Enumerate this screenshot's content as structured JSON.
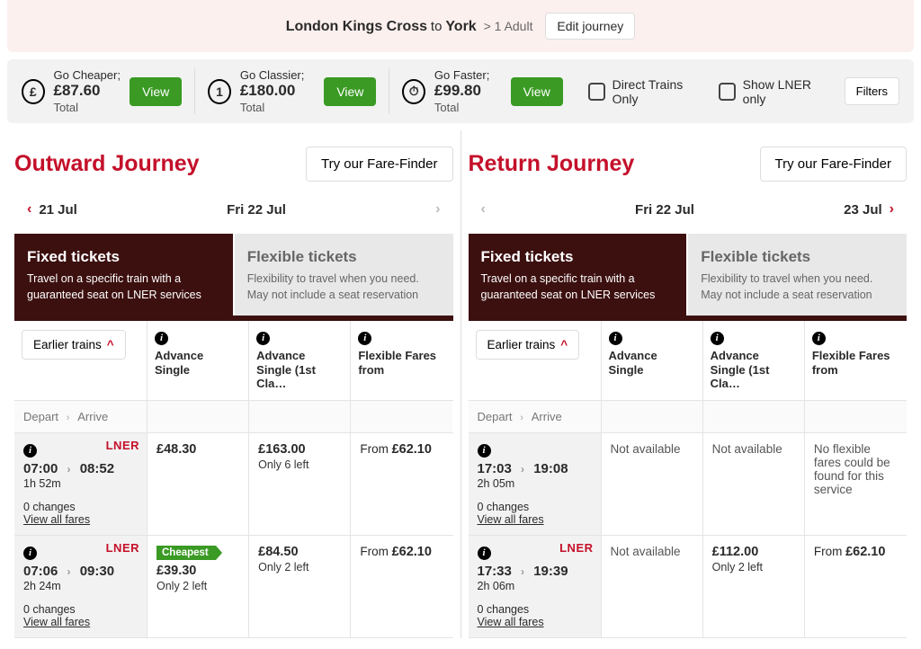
{
  "journey": {
    "from": "London Kings Cross",
    "to_word": "to",
    "dest": "York",
    "pax": "> 1 Adult",
    "edit": "Edit journey"
  },
  "promos": {
    "cheaper": {
      "label": "Go Cheaper;",
      "price": "£87.60",
      "total": "Total",
      "view": "View"
    },
    "classier": {
      "label": "Go Classier;",
      "price": "£180.00",
      "total": "Total",
      "view": "View",
      "icon": "1"
    },
    "faster": {
      "label": "Go Faster;",
      "price": "£99.80",
      "total": "Total",
      "view": "View"
    }
  },
  "filters": {
    "direct": "Direct Trains Only",
    "lner_only": "Show LNER only",
    "filters_btn": "Filters"
  },
  "outward": {
    "title": "Outward Journey",
    "fare_finder": "Try our Fare-Finder",
    "prev": "21 Jul",
    "date": "Fri 22 Jul",
    "next": "",
    "tabs": {
      "fixed_title": "Fixed tickets",
      "fixed_sub": "Travel on a specific train with a guaranteed seat on LNER services",
      "flex_title": "Flexible tickets",
      "flex_sub": "Flexibility to travel when you need. May not include a seat reservation"
    },
    "cols": {
      "adv": "Advance Single",
      "adv1": "Advance Single (1st Cla…",
      "flex": "Flexible Fares from"
    },
    "earlier": "Earlier trains",
    "depart": "Depart",
    "arrive": "Arrive",
    "rows": [
      {
        "dep": "07:00",
        "arr": "08:52",
        "dur": "1h 52m",
        "changes": "0 changes",
        "view": "View all fares",
        "lner": "LNER",
        "c1": {
          "price": "£48.30",
          "note": ""
        },
        "c2": {
          "price": "£163.00",
          "note": "Only 6 left"
        },
        "c3": {
          "prefix": "From ",
          "price": "£62.10"
        }
      },
      {
        "dep": "07:06",
        "arr": "09:30",
        "dur": "2h 24m",
        "changes": "0 changes",
        "view": "View all fares",
        "lner": "LNER",
        "c1": {
          "badge": "Cheapest",
          "price": "£39.30",
          "note": "Only 2 left"
        },
        "c2": {
          "price": "£84.50",
          "note": "Only 2 left"
        },
        "c3": {
          "prefix": "From ",
          "price": "£62.10"
        }
      }
    ]
  },
  "return": {
    "title": "Return Journey",
    "fare_finder": "Try our Fare-Finder",
    "prev": "",
    "date": "Fri 22 Jul",
    "next": "23 Jul",
    "tabs": {
      "fixed_title": "Fixed tickets",
      "fixed_sub": "Travel on a specific train with a guaranteed seat on LNER services",
      "flex_title": "Flexible tickets",
      "flex_sub": "Flexibility to travel when you need. May not include a seat reservation"
    },
    "cols": {
      "adv": "Advance Single",
      "adv1": "Advance Single (1st Cla…",
      "flex": "Flexible Fares from"
    },
    "earlier": "Earlier trains",
    "depart": "Depart",
    "arrive": "Arrive",
    "rows": [
      {
        "dep": "17:03",
        "arr": "19:08",
        "dur": "2h 05m",
        "changes": "0 changes",
        "view": "View all fares",
        "lner": "",
        "c1": {
          "na": "Not available"
        },
        "c2": {
          "na": "Not available"
        },
        "c3": {
          "na": "No flexible fares could be found for this service"
        }
      },
      {
        "dep": "17:33",
        "arr": "19:39",
        "dur": "2h 06m",
        "changes": "0 changes",
        "view": "View all fares",
        "lner": "LNER",
        "c1": {
          "na": "Not available"
        },
        "c2": {
          "price": "£112.00",
          "note": "Only 2 left"
        },
        "c3": {
          "prefix": "From ",
          "price": "£62.10"
        }
      }
    ]
  }
}
